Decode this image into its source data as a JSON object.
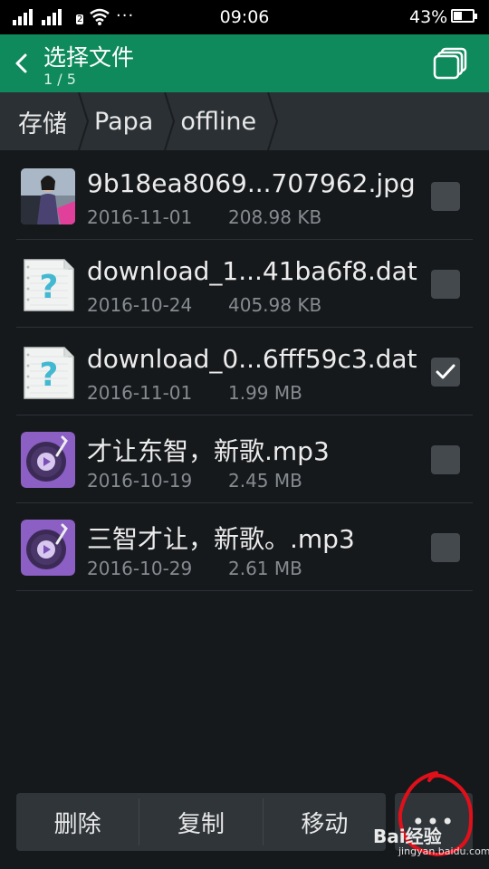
{
  "status_bar": {
    "time": "09:06",
    "battery_percent": "43%",
    "battery_level": 0.43,
    "network_badge": "2",
    "more_indicator": "···"
  },
  "app_bar": {
    "title": "选择文件",
    "subtitle": "1 / 5",
    "background": "#0e8a5c"
  },
  "breadcrumb": [
    "存储",
    "Papa",
    "offline"
  ],
  "files": [
    {
      "name": "9b18ea8069...707962.jpg",
      "date": "2016-11-01",
      "size": "208.98 KB",
      "icon": "image-thumbnail",
      "checked": false
    },
    {
      "name": "download_1...41ba6f8.dat",
      "date": "2016-10-24",
      "size": "405.98 KB",
      "icon": "unknown-file-icon",
      "checked": false
    },
    {
      "name": "download_0...6fff59c3.dat",
      "date": "2016-11-01",
      "size": "1.99 MB",
      "icon": "unknown-file-icon",
      "checked": true
    },
    {
      "name": "才让东智，新歌.mp3",
      "date": "2016-10-19",
      "size": "2.45 MB",
      "icon": "music-file-icon",
      "checked": false
    },
    {
      "name": "三智才让，新歌。.mp3",
      "date": "2016-10-29",
      "size": "2.61 MB",
      "icon": "music-file-icon",
      "checked": false
    }
  ],
  "bottom_actions": {
    "delete": "删除",
    "copy": "复制",
    "move": "移动",
    "more": "•••"
  },
  "watermark": {
    "text": "Bai经验",
    "url": "jingyan.baidu.com"
  }
}
